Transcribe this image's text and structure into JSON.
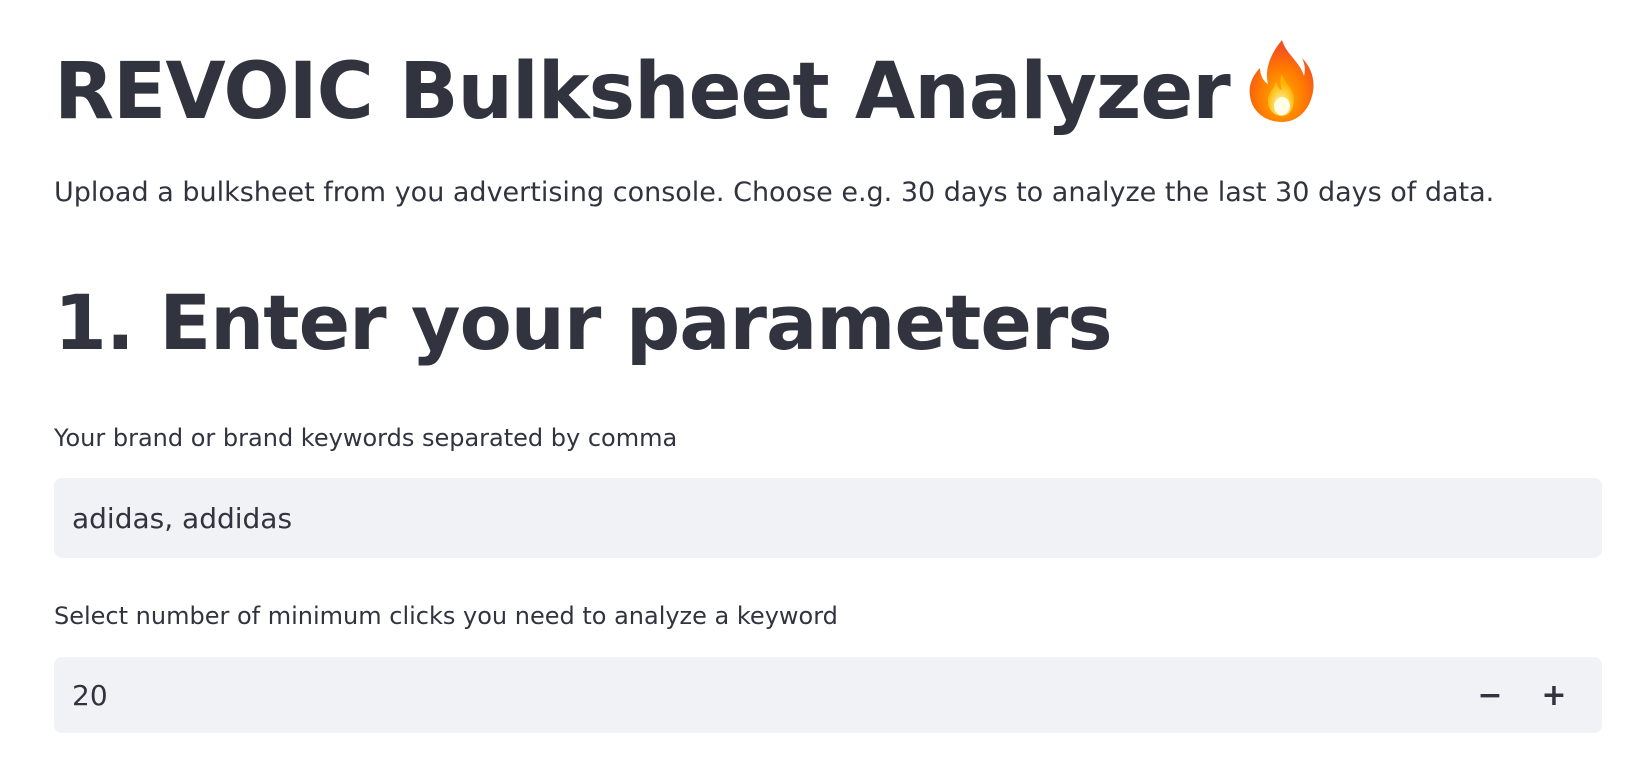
{
  "header": {
    "title": "REVOIC Bulksheet Analyzer",
    "title_icon": "fire-icon",
    "subtitle": "Upload a bulksheet from you advertising console. Choose e.g. 30 days to analyze the last 30 days of data."
  },
  "section1": {
    "title": "1. Enter your parameters",
    "brand_field": {
      "label": "Your brand or brand keywords separated by comma",
      "value": "adidas, addidas"
    },
    "clicks_field": {
      "label": "Select number of minimum clicks you need to analyze a keyword",
      "value": "20",
      "decrement_label": "−",
      "increment_label": "+"
    }
  }
}
